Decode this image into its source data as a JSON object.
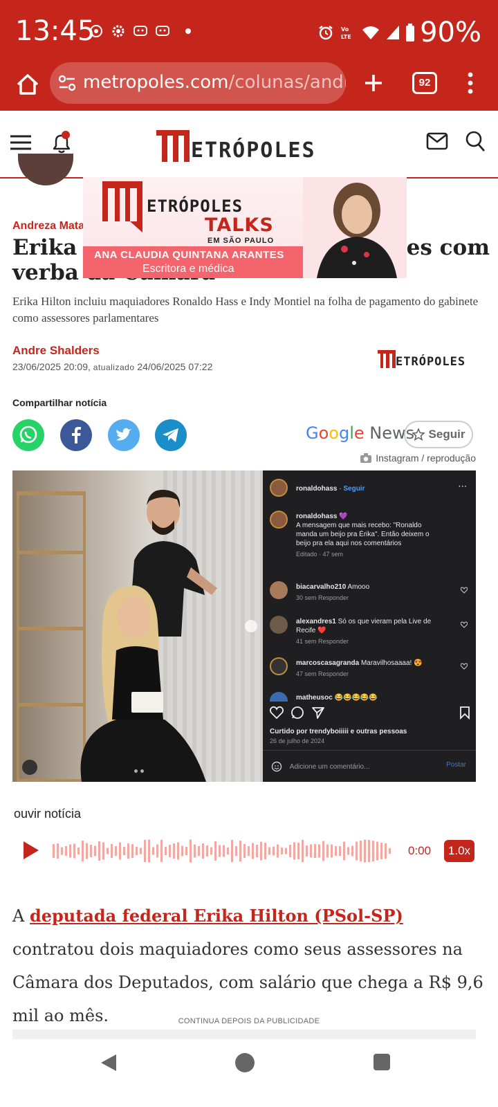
{
  "status_bar": {
    "time": "13:45",
    "battery": "90%",
    "network": "Vo) LTE"
  },
  "browser": {
    "url_host": "metropoles.com",
    "url_path": "/colunas/andreza",
    "tab_count": "92"
  },
  "site": {
    "logo_text": "ETRÓPOLES"
  },
  "ad": {
    "title": "ETRÓPOLES",
    "talks": "TALKS",
    "location": "EM SÃO PAULO",
    "name": "ANA CLAUDIA QUINTANA ARANTES",
    "role": "Escritora e médica"
  },
  "article": {
    "kicker": "Andreza Mata",
    "headline_left": "Erika H",
    "headline_right": "es com",
    "headline_line2": "verba da Câmara",
    "standfirst": "Erika Hilton incluiu maquiadores Ronaldo Hass e Indy Montiel na folha de pagamento do gabinete como assessores parlamentares",
    "author": "Andre Shalders",
    "published": "23/06/2025 20:09,",
    "updated_label": "atualizado",
    "updated": "24/06/2025 07:22",
    "share_label": "Compartilhar notícia",
    "google_news": {
      "g": "G",
      "o1": "o",
      "o2": "o",
      "g2": "g",
      "l": "l",
      "e": "e",
      "news": "News"
    },
    "follow_label": "Seguir",
    "photo_credit": "Instagram / reprodução"
  },
  "instagram": {
    "account": "ronaldohass",
    "follow": "Seguir",
    "caption_user": "ronaldohass 💜",
    "caption_text": "A mensagem que mais recebo: \"Ronaldo manda um beijo pra Érika\". Então deixem o beijo pra ela aqui nos comentários",
    "caption_meta": "Editado · 47 sem",
    "comments": [
      {
        "user": "biacarvalho210",
        "text": "Amooo",
        "meta": "30 sem   Responder"
      },
      {
        "user": "alexandres1",
        "text": "Só os que vieram pela Live de Recife ❤️",
        "meta": "41 sem   Responder"
      },
      {
        "user": "marcoscasagranda",
        "text": "Maravilhosaaaa! 😍",
        "meta": "47 sem   Responder"
      },
      {
        "user": "matheusoc",
        "text": "😂😂😂😂😂",
        "meta": ""
      }
    ],
    "liked_by": "Curtido por trendyboiiiii e outras pessoas",
    "date": "26 de julho de 2024",
    "comment_placeholder": "Adicione um comentário...",
    "post": "Postar"
  },
  "audio": {
    "label": "ouvir notícia",
    "time": "0:00",
    "speed": "1.0x"
  },
  "body": {
    "prefix": "A ",
    "link": "deputada federal Erika Hilton (PSol-SP)",
    "text": " contratou dois maquiadores como seus assessores na Câmara dos Deputados, com salário que chega a R$ 9,6 mil ao mês."
  },
  "continua": "CONTINUA DEPOIS DA PUBLICIDADE",
  "colors": {
    "brand": "#c5261c",
    "whatsapp": "#25d366",
    "facebook": "#3b5998",
    "twitter": "#55acee",
    "telegram": "#1b8ec9"
  }
}
